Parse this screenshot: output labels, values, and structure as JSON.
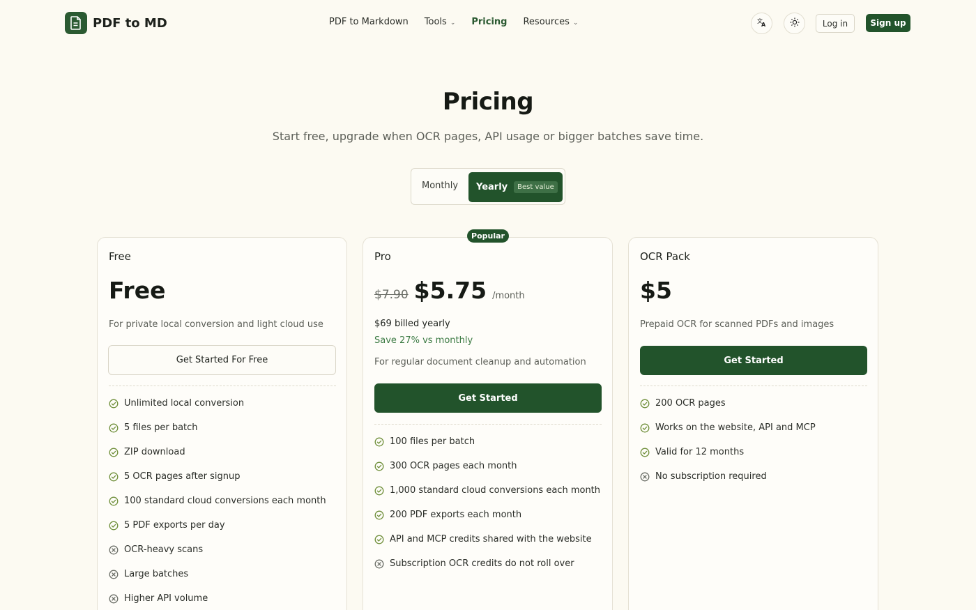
{
  "header": {
    "logo_text": "PDF to MD",
    "nav": [
      {
        "label": "PDF to Markdown",
        "has_dropdown": false,
        "active": false
      },
      {
        "label": "Tools",
        "has_dropdown": true,
        "active": false
      },
      {
        "label": "Pricing",
        "has_dropdown": false,
        "active": true
      },
      {
        "label": "Resources",
        "has_dropdown": true,
        "active": false
      }
    ],
    "language_icon": "translate-icon",
    "theme_icon": "sun-icon",
    "login_label": "Log in",
    "signup_label": "Sign up"
  },
  "hero": {
    "title": "Pricing",
    "subtitle": "Start free, upgrade when OCR pages, API usage or bigger batches save time."
  },
  "billing_toggle": {
    "monthly_label": "Monthly",
    "yearly_label": "Yearly",
    "yearly_badge": "Best value",
    "selected": "Yearly"
  },
  "plans": [
    {
      "name": "Free",
      "price": "Free",
      "description": "For private local conversion and light cloud use",
      "cta": "Get Started For Free",
      "features": [
        {
          "text": "Unlimited local conversion",
          "included": true
        },
        {
          "text": "5 files per batch",
          "included": true
        },
        {
          "text": "ZIP download",
          "included": true
        },
        {
          "text": "5 OCR pages after signup",
          "included": true
        },
        {
          "text": "100 standard cloud conversions each month",
          "included": true
        },
        {
          "text": "5 PDF exports per day",
          "included": true
        },
        {
          "text": "OCR-heavy scans",
          "included": false
        },
        {
          "text": "Large batches",
          "included": false
        },
        {
          "text": "Higher API volume",
          "included": false
        }
      ]
    },
    {
      "name": "Pro",
      "badge": "Popular",
      "old_price": "$7.90",
      "price": "$5.75",
      "period": "/month",
      "billed": "$69 billed yearly",
      "savings": "Save 27% vs monthly",
      "description": "For regular document cleanup and automation",
      "cta": "Get Started",
      "features": [
        {
          "text": "100 files per batch",
          "included": true
        },
        {
          "text": "300 OCR pages each month",
          "included": true
        },
        {
          "text": "1,000 standard cloud conversions each month",
          "included": true
        },
        {
          "text": "200 PDF exports each month",
          "included": true
        },
        {
          "text": "API and MCP credits shared with the website",
          "included": true
        },
        {
          "text": "Subscription OCR credits do not roll over",
          "included": false
        }
      ]
    },
    {
      "name": "OCR Pack",
      "price": "$5",
      "description": "Prepaid OCR for scanned PDFs and images",
      "cta": "Get Started",
      "features": [
        {
          "text": "200 OCR pages",
          "included": true
        },
        {
          "text": "Works on the website, API and MCP",
          "included": true
        },
        {
          "text": "Valid for 12 months",
          "included": true
        },
        {
          "text": "No subscription required",
          "included": false
        }
      ]
    }
  ],
  "colors": {
    "background": "#fcfaf2",
    "brand_green": "#22532b",
    "check_green": "#6f8f3a",
    "savings_green": "#3b7a43"
  }
}
